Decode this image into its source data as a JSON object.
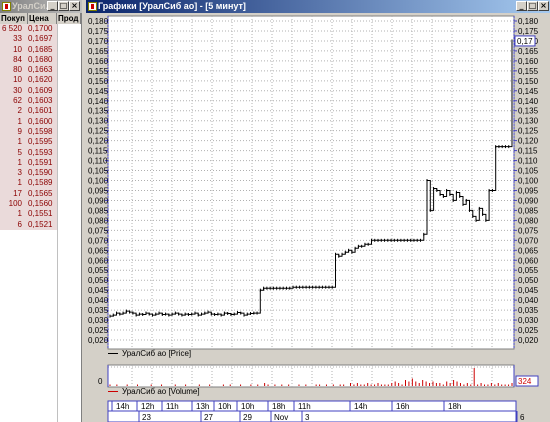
{
  "orderbook": {
    "title": "УралСи...",
    "columns": [
      "Покуп",
      "Цена",
      "Прод"
    ],
    "rows": [
      {
        "bid": "6 520",
        "price": "0,1700"
      },
      {
        "bid": "33",
        "price": "0,1697"
      },
      {
        "bid": "10",
        "price": "0,1685"
      },
      {
        "bid": "84",
        "price": "0,1680"
      },
      {
        "bid": "80",
        "price": "0,1663"
      },
      {
        "bid": "10",
        "price": "0,1620"
      },
      {
        "bid": "30",
        "price": "0,1609"
      },
      {
        "bid": "62",
        "price": "0,1603"
      },
      {
        "bid": "2",
        "price": "0,1601"
      },
      {
        "bid": "1",
        "price": "0,1600"
      },
      {
        "bid": "9",
        "price": "0,1598"
      },
      {
        "bid": "1",
        "price": "0,1595"
      },
      {
        "bid": "5",
        "price": "0,1593"
      },
      {
        "bid": "1",
        "price": "0,1591"
      },
      {
        "bid": "3",
        "price": "0,1590"
      },
      {
        "bid": "1",
        "price": "0,1589"
      },
      {
        "bid": "17",
        "price": "0,1565"
      },
      {
        "bid": "100",
        "price": "0,1560"
      },
      {
        "bid": "1",
        "price": "0,1551"
      },
      {
        "bid": "6",
        "price": "0,1521"
      }
    ]
  },
  "chart_window": {
    "title": "Графики [УралСиб ао] - [5 минут]"
  },
  "chart_data": [
    {
      "type": "line",
      "title": "",
      "legend": "УралСиб ао [Price]",
      "y_ticks": [
        "0,180",
        "0,175",
        "0,170",
        "0,165",
        "0,160",
        "0,155",
        "0,150",
        "0,145",
        "0,140",
        "0,135",
        "0,130",
        "0,125",
        "0,120",
        "0,115",
        "0,110",
        "0,105",
        "0,100",
        "0,095",
        "0,090",
        "0,085",
        "0,080",
        "0,075",
        "0,070",
        "0,065",
        "0,060",
        "0,055",
        "0,050",
        "0,045",
        "0,040",
        "0,035",
        "0,030",
        "0,025",
        "0,020"
      ],
      "ylim": [
        0.02,
        0.18
      ],
      "current_value": "0,17",
      "series": [
        {
          "values": [
            0.032,
            0.0325,
            0.0335,
            0.033,
            0.0335,
            0.0345,
            0.034,
            0.0335,
            0.0325,
            0.033,
            0.0328,
            0.0335,
            0.033,
            0.0325,
            0.033,
            0.0335,
            0.0328,
            0.033,
            0.0325,
            0.033,
            0.0335,
            0.033,
            0.0325,
            0.033,
            0.0328,
            0.033,
            0.0335,
            0.0325,
            0.033,
            0.0335,
            0.034,
            0.033,
            0.0328,
            0.033,
            0.0325,
            0.0335,
            0.0333,
            0.0328,
            0.033,
            0.0338,
            0.0335,
            0.0325,
            0.033,
            0.0333,
            0.0335,
            0.0335,
            0.045,
            0.046,
            0.046,
            0.046,
            0.046,
            0.046,
            0.046,
            0.046,
            0.046,
            0.046,
            0.0465,
            0.0465,
            0.0465,
            0.0465,
            0.0465,
            0.0465,
            0.0465,
            0.0465,
            0.0465,
            0.0465,
            0.0465,
            0.0465,
            0.0465,
            0.063,
            0.062,
            0.063,
            0.064,
            0.065,
            0.064,
            0.066,
            0.067,
            0.067,
            0.068,
            0.068,
            0.07,
            0.07,
            0.07,
            0.07,
            0.07,
            0.07,
            0.07,
            0.07,
            0.07,
            0.07,
            0.07,
            0.07,
            0.07,
            0.07,
            0.07,
            0.07,
            0.073,
            0.1,
            0.085,
            0.096,
            0.095,
            0.093,
            0.092,
            0.095,
            0.093,
            0.09,
            0.094,
            0.092,
            0.088,
            0.09,
            0.085,
            0.082,
            0.08,
            0.086,
            0.083,
            0.08,
            0.095,
            0.095,
            0.117,
            0.117,
            0.117,
            0.117,
            0.117,
            0.17
          ]
        }
      ]
    },
    {
      "type": "bar",
      "legend": "УралСиб ао [Volume]",
      "y_ticks": [
        "0"
      ],
      "current_value": "324",
      "values": [
        1,
        0,
        1,
        0,
        0,
        1,
        0,
        0,
        1,
        0,
        0,
        0,
        1,
        0,
        0,
        1,
        0,
        0,
        0,
        1,
        0,
        0,
        1,
        0,
        0,
        0,
        1,
        0,
        0,
        1,
        0,
        0,
        0,
        1,
        0,
        1,
        0,
        0,
        1,
        0,
        0,
        1,
        0,
        1,
        0,
        2,
        1,
        0,
        1,
        0,
        1,
        0,
        1,
        0,
        0,
        1,
        0,
        1,
        0,
        0,
        1,
        1,
        0,
        1,
        0,
        1,
        0,
        1,
        1,
        0,
        2,
        1,
        2,
        1,
        1,
        2,
        1,
        1,
        2,
        1,
        1,
        1,
        2,
        3,
        2,
        1,
        4,
        3,
        5,
        3,
        2,
        4,
        3,
        2,
        3,
        2,
        2,
        1,
        3,
        2,
        4,
        3,
        2,
        1,
        2,
        1,
        12,
        1,
        2,
        1,
        1,
        2,
        1,
        2,
        1,
        1,
        1,
        2
      ]
    }
  ],
  "time_axis": {
    "hours": [
      "14h",
      "12h",
      "11h",
      "13h",
      "10h",
      "10h",
      "18h",
      "11h",
      "14h",
      "16h",
      "18h"
    ],
    "dates": [
      "23",
      "27",
      "29",
      "Nov",
      "3",
      "6"
    ]
  }
}
